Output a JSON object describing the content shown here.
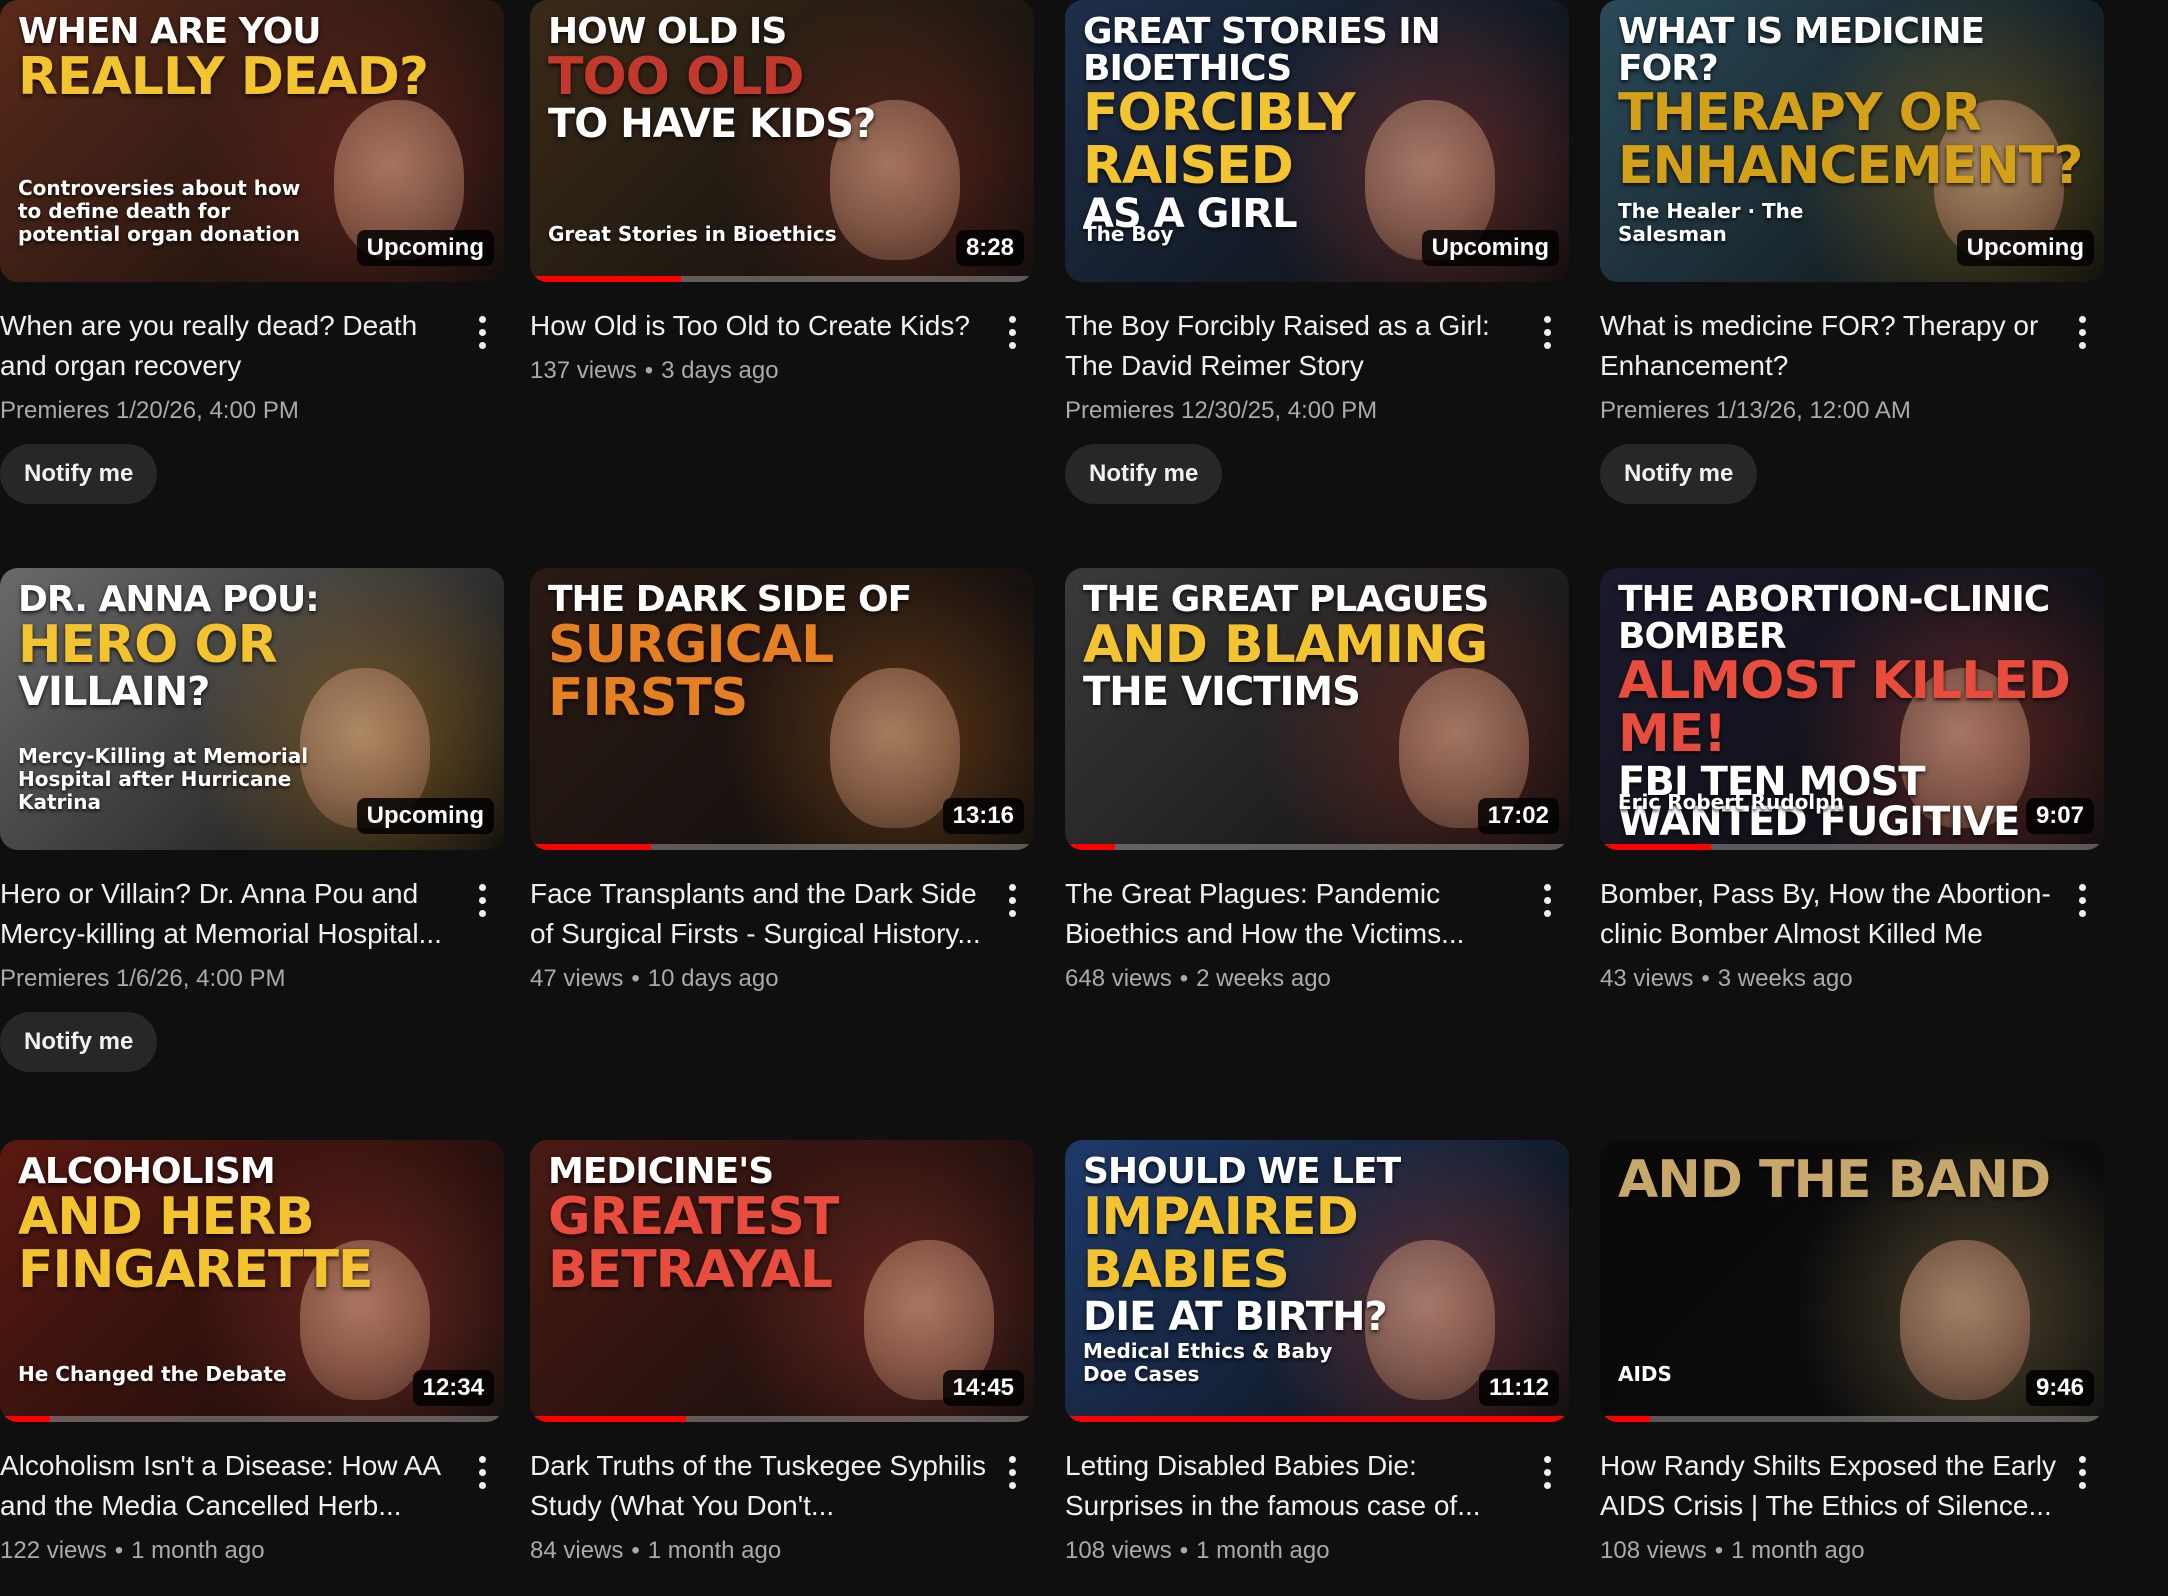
{
  "videos": [
    {
      "title": "When are you really dead? Death and organ recovery",
      "views": "",
      "age": "",
      "premiere": "Premieres 1/20/26, 4:00 PM",
      "badge": "Upcoming",
      "notify_label": "Notify me",
      "progress": 0,
      "thumb": {
        "l1": "When are you",
        "l2": "Really Dead?",
        "l3": "",
        "sub": "Controversies about how to define death for potential organ donation",
        "bg": "#5a2a1a",
        "accent": "#c0392b"
      }
    },
    {
      "title": "How Old is Too Old to Create Kids?",
      "views": "137 views",
      "age": "3 days ago",
      "premiere": "",
      "badge": "8:28",
      "notify_label": "",
      "progress": 0.3,
      "thumb": {
        "l1": "How Old Is",
        "l2": "Too Old",
        "l3": "To Have Kids?",
        "sub": "Great Stories in Bioethics",
        "bg": "#3a2a18",
        "accent": "#c0392b"
      }
    },
    {
      "title": "The Boy Forcibly Raised as a Girl: The David Reimer Story",
      "views": "",
      "age": "",
      "premiere": "Premieres 12/30/25, 4:00 PM",
      "badge": "Upcoming",
      "notify_label": "Notify me",
      "progress": 0,
      "thumb": {
        "l1": "Great Stories in Bioethics",
        "l2": "Forcibly Raised",
        "l3": "as a Girl",
        "sub": "The Boy",
        "bg": "#1e2f4a",
        "accent": "#e74c3c"
      }
    },
    {
      "title": "What is medicine FOR? Therapy or Enhancement?",
      "views": "",
      "age": "",
      "premiere": "Premieres 1/13/26, 12:00 AM",
      "badge": "Upcoming",
      "notify_label": "Notify me",
      "progress": 0,
      "thumb": {
        "l1": "What is medicine FOR?",
        "l2": "Therapy or Enhancement?",
        "l3": "",
        "sub": "The Healer · The Salesman",
        "bg": "#2a4a5a",
        "accent": "#d4a017"
      }
    },
    {
      "title": "Hero or Villain? Dr. Anna Pou and Mercy-killing at Memorial Hospital...",
      "views": "",
      "age": "",
      "premiere": "Premieres 1/6/26, 4:00 PM",
      "badge": "Upcoming",
      "notify_label": "Notify me",
      "progress": 0,
      "thumb": {
        "l1": "Dr. Anna Pou:",
        "l2": "Hero or",
        "l3": "Villain?",
        "sub": "Mercy-Killing at Memorial Hospital after Hurricane Katrina",
        "bg": "#6a6a6a",
        "accent": "#f39c12"
      }
    },
    {
      "title": "Face Transplants and the Dark Side of Surgical Firsts - Surgical History...",
      "views": "47 views",
      "age": "10 days ago",
      "premiere": "",
      "badge": "13:16",
      "notify_label": "",
      "progress": 0.24,
      "thumb": {
        "l1": "The Dark Side of",
        "l2": "Surgical Firsts",
        "l3": "",
        "sub": "",
        "bg": "#2a1a14",
        "accent": "#e67e22"
      }
    },
    {
      "title": "The Great Plagues: Pandemic Bioethics and How the Victims...",
      "views": "648 views",
      "age": "2 weeks ago",
      "premiere": "",
      "badge": "17:02",
      "notify_label": "",
      "progress": 0.1,
      "thumb": {
        "l1": "The Great Plagues",
        "l2": "and Blaming",
        "l3": "the Victims",
        "sub": "",
        "bg": "#3a3a3a",
        "accent": "#c0392b"
      }
    },
    {
      "title": "Bomber, Pass By, How the Abortion-clinic Bomber Almost Killed Me",
      "views": "43 views",
      "age": "3 weeks ago",
      "premiere": "",
      "badge": "9:07",
      "notify_label": "",
      "progress": 0.22,
      "thumb": {
        "l1": "The Abortion-Clinic Bomber",
        "l2": "Almost Killed Me!",
        "l3": "FBI Ten Most Wanted Fugitive",
        "sub": "Eric Robert Rudolph",
        "bg": "#1a1a2e",
        "accent": "#e74c3c"
      }
    },
    {
      "title": "Alcoholism Isn't a Disease: How AA and the Media Cancelled Herb...",
      "views": "122 views",
      "age": "1 month ago",
      "premiere": "",
      "badge": "12:34",
      "notify_label": "",
      "progress": 0.1,
      "thumb": {
        "l1": "Alcoholism",
        "l2": "and Herb Fingarette",
        "l3": "",
        "sub": "He Changed the Debate",
        "bg": "#5a1810",
        "accent": "#e74c3c"
      }
    },
    {
      "title": "Dark Truths of the Tuskegee Syphilis Study (What You Don't...",
      "views": "84 views",
      "age": "1 month ago",
      "premiere": "",
      "badge": "14:45",
      "notify_label": "",
      "progress": 0.31,
      "thumb": {
        "l1": "Medicine's",
        "l2": "Greatest Betrayal",
        "l3": "",
        "sub": "",
        "bg": "#4a1a14",
        "accent": "#e74c3c"
      }
    },
    {
      "title": "Letting Disabled Babies Die: Surprises in the famous case of...",
      "views": "108 views",
      "age": "1 month ago",
      "premiere": "",
      "badge": "11:12",
      "notify_label": "",
      "progress": 1.0,
      "thumb": {
        "l1": "Should We Let",
        "l2": "Impaired Babies",
        "l3": "Die at Birth?",
        "sub": "Medical Ethics & Baby Doe Cases",
        "bg": "#1e3a6a",
        "accent": "#e74c3c"
      }
    },
    {
      "title": "How Randy Shilts Exposed the Early AIDS Crisis | The Ethics of Silence...",
      "views": "108 views",
      "age": "1 month ago",
      "premiere": "",
      "badge": "9:46",
      "notify_label": "",
      "progress": 0.1,
      "thumb": {
        "l1": "",
        "l2": "And the Band",
        "l3": "",
        "sub": "AIDS",
        "bg": "#0a0a0a",
        "accent": "#c8a86a"
      }
    }
  ]
}
